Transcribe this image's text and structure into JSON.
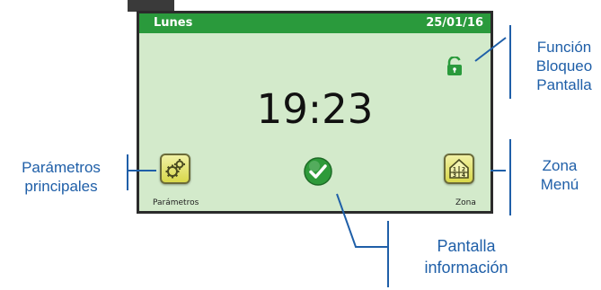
{
  "screen": {
    "day": "Lunes",
    "date": "25/01/16",
    "time": "19:23",
    "parametros_label": "Parámetros",
    "zona_label": "Zona"
  },
  "callouts": {
    "funcion_line1": "Función",
    "funcion_line2": "Bloqueo",
    "funcion_line3": "Pantalla",
    "parametros_line1": "Parámetros",
    "parametros_line2": "principales",
    "zona_line1": "Zona",
    "zona_line2": "Menú",
    "pantalla_line1": "Pantalla",
    "pantalla_line2": "información"
  },
  "colors": {
    "header_green": "#2a9a3c",
    "screen_bg": "#d3eacb",
    "callout_blue": "#1f5fa8",
    "button_yellow": "#e6e670",
    "check_green": "#2e9a3a"
  },
  "icons": {
    "lock": "unlocked-padlock-icon",
    "params": "gears-icon",
    "zone": "house-zones-icon",
    "info": "checkmark-icon"
  }
}
